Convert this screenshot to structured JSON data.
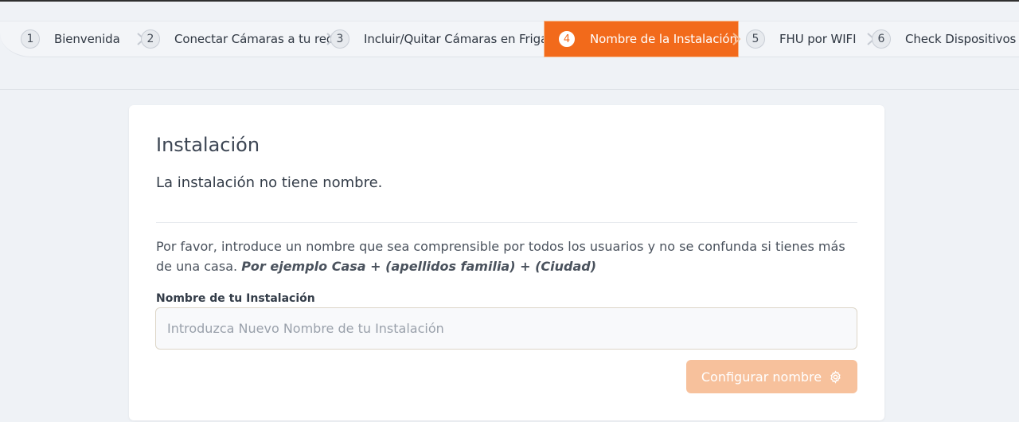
{
  "stepper": {
    "steps": [
      {
        "number": "1",
        "label": "Bienvenida"
      },
      {
        "number": "2",
        "label": "Conectar Cámaras a tu red"
      },
      {
        "number": "3",
        "label": "Incluir/Quitar Cámaras en Frigate"
      },
      {
        "number": "4",
        "label": "Nombre de la Instalación"
      },
      {
        "number": "5",
        "label": "FHU por WIFI"
      },
      {
        "number": "6",
        "label": "Check Dispositivos"
      }
    ],
    "active_color": "#f26a1b"
  },
  "card": {
    "title": "Instalación",
    "subtitle": "La instalación no tiene nombre.",
    "description": "Por favor, introduce un nombre que sea comprensible por todos los usuarios y no se confunda si tienes más de una casa.",
    "example": "Por ejemplo Casa + (apellidos familia) + (Ciudad)",
    "field_label": "Nombre de tu Instalación",
    "field_placeholder": "Introduzca Nuevo Nombre de tu Instalación",
    "field_value": "",
    "button_label": "Configurar nombre",
    "button_icon": "gear-icon",
    "button_color": "#f7c19c"
  }
}
